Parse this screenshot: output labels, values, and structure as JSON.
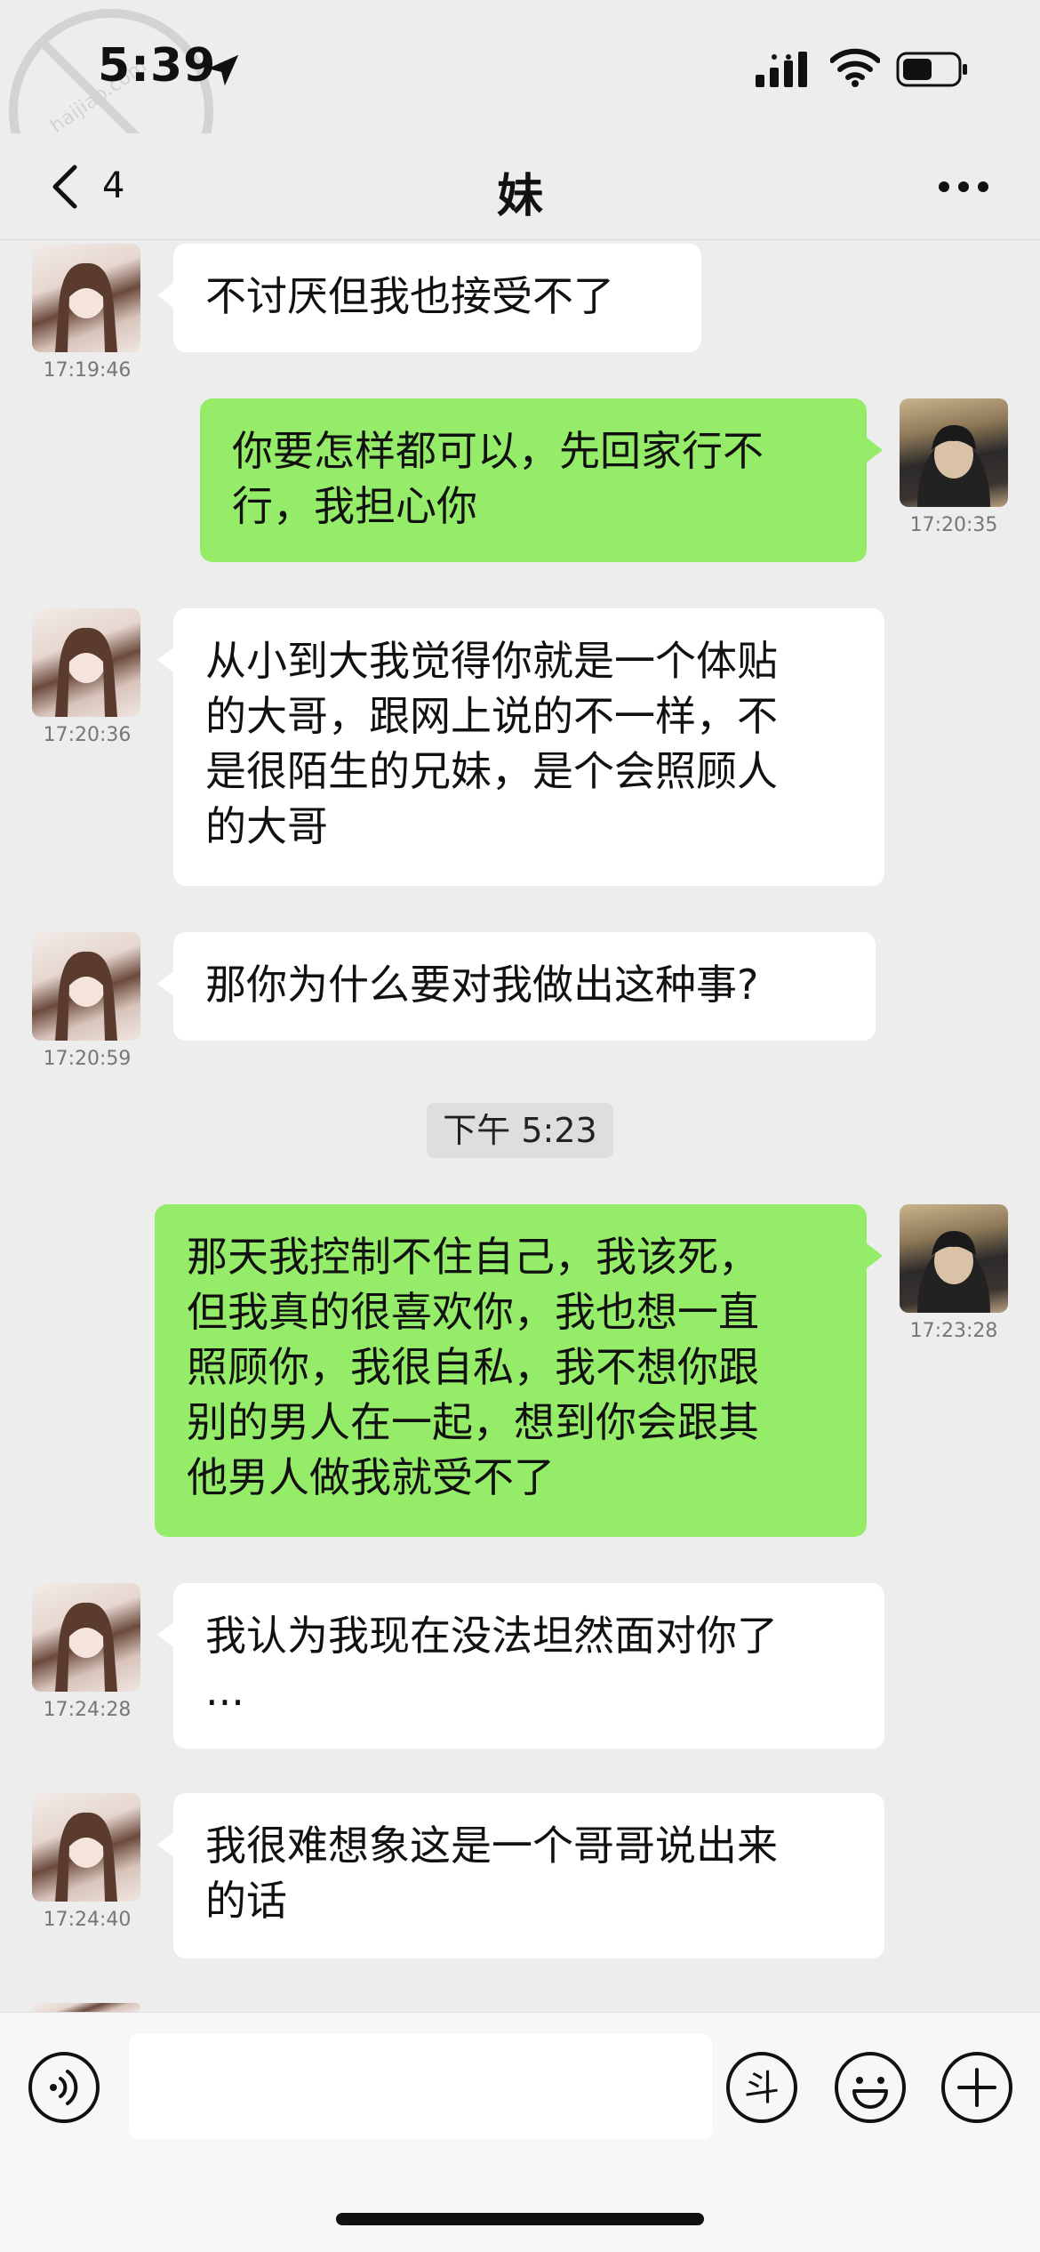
{
  "status_bar": {
    "time": "5:39",
    "watermark_text": "haijiao.com"
  },
  "nav": {
    "back_count": "4",
    "title": "妹"
  },
  "messages": [
    {
      "side": "in",
      "text": "不讨厌但我也接受不了",
      "time": "17:19:46"
    },
    {
      "side": "out",
      "text": "你要怎样都可以，先回家行不\n行，我担心你",
      "time": "17:20:35"
    },
    {
      "side": "in",
      "text": "从小到大我觉得你就是一个体贴\n的大哥，跟网上说的不一样，不\n是很陌生的兄妹，是个会照顾人\n的大哥",
      "time": "17:20:36"
    },
    {
      "side": "in",
      "text": "那你为什么要对我做出这种事?",
      "time": "17:20:59"
    },
    {
      "side": "out",
      "text": "那天我控制不住自己，我该死，\n但我真的很喜欢你，我也想一直\n照顾你，我很自私，我不想你跟\n别的男人在一起，想到你会跟其\n他男人做我就受不了",
      "time": "17:23:28"
    },
    {
      "side": "in",
      "text": "我认为我现在没法坦然面对你了\n...",
      "time": "17:24:28"
    },
    {
      "side": "in",
      "text": "我很难想象这是一个哥哥说出来\n的话",
      "time": "17:24:40"
    }
  ],
  "time_separator": "下午 5:23",
  "input": {
    "value": "",
    "dou_label": "斗"
  },
  "colors": {
    "background": "#ededed",
    "outgoing_bubble": "#95ec69",
    "incoming_bubble": "#ffffff"
  }
}
